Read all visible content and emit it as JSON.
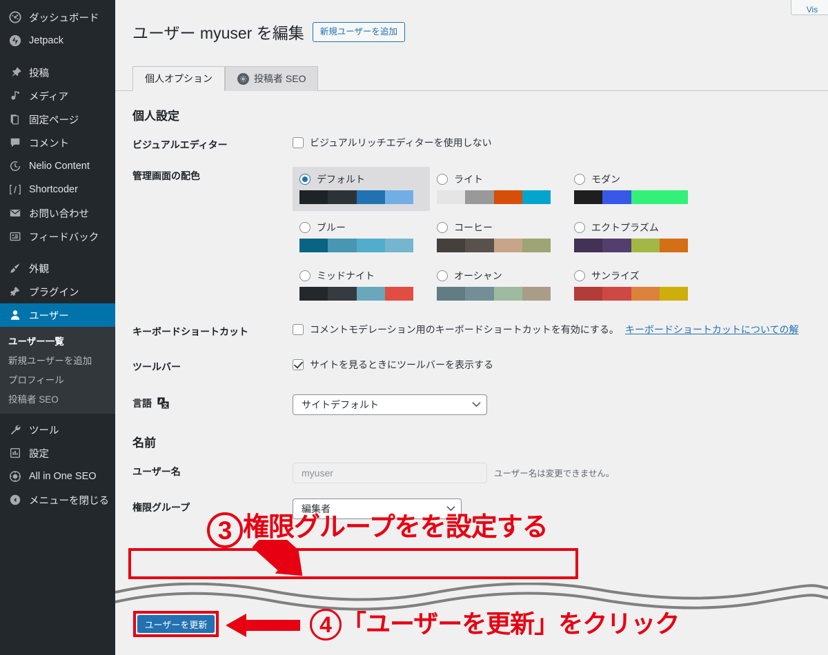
{
  "sidebar": {
    "items": [
      {
        "label": "ダッシュボード",
        "icon": "dashboard-icon",
        "active": false
      },
      {
        "label": "Jetpack",
        "icon": "jetpack-icon",
        "active": false
      },
      {
        "label": "投稿",
        "icon": "pin-icon",
        "active": false
      },
      {
        "label": "メディア",
        "icon": "media-icon",
        "active": false
      },
      {
        "label": "固定ページ",
        "icon": "pages-icon",
        "active": false
      },
      {
        "label": "コメント",
        "icon": "comment-icon",
        "active": false
      },
      {
        "label": "Nelio Content",
        "icon": "clock-icon",
        "active": false
      },
      {
        "label": "Shortcoder",
        "icon": "code-icon",
        "active": false
      },
      {
        "label": "お問い合わせ",
        "icon": "mail-icon",
        "active": false
      },
      {
        "label": "フィードバック",
        "icon": "feedback-icon",
        "active": false
      },
      {
        "label": "外観",
        "icon": "brush-icon",
        "active": false
      },
      {
        "label": "プラグイン",
        "icon": "plugin-icon",
        "active": false
      },
      {
        "label": "ユーザー",
        "icon": "user-icon",
        "active": true
      }
    ],
    "submenu": [
      {
        "label": "ユーザー一覧",
        "current": true
      },
      {
        "label": "新規ユーザーを追加",
        "current": false
      },
      {
        "label": "プロフィール",
        "current": false
      },
      {
        "label": "投稿者 SEO",
        "current": false
      }
    ],
    "items_bottom": [
      {
        "label": "ツール",
        "icon": "wrench-icon",
        "active": false
      },
      {
        "label": "設定",
        "icon": "settings-icon",
        "active": false
      },
      {
        "label": "All in One SEO",
        "icon": "aioseo-icon",
        "active": false
      },
      {
        "label": "メニューを閉じる",
        "icon": "collapse-icon",
        "active": false
      }
    ]
  },
  "header": {
    "title": "ユーザー myuser を編集",
    "add_new_label": "新規ユーザーを追加",
    "corner_button_label": "Vis"
  },
  "tabs": [
    {
      "label": "個人オプション",
      "icon": null,
      "active": true
    },
    {
      "label": "投稿者 SEO",
      "icon": "gear-icon",
      "active": false
    }
  ],
  "personal_settings": {
    "heading": "個人設定",
    "visual_editor": {
      "label": "ビジュアルエディター",
      "checkbox_label": "ビジュアルリッチエディターを使用しない",
      "checked": false
    },
    "admin_color_scheme": {
      "label": "管理画面の配色",
      "schemes": [
        {
          "name": "デフォルト",
          "selected": true,
          "colors": [
            "#1d2327",
            "#2c3338",
            "#2271b1",
            "#72aee6"
          ]
        },
        {
          "name": "ライト",
          "selected": false,
          "colors": [
            "#e5e5e5",
            "#999999",
            "#d64e07",
            "#04a4cc"
          ]
        },
        {
          "name": "モダン",
          "selected": false,
          "colors": [
            "#1e1e1e",
            "#3858e9",
            "#33f078",
            "#33f078"
          ]
        },
        {
          "name": "ブルー",
          "selected": false,
          "colors": [
            "#096484",
            "#4796b3",
            "#52accc",
            "#74b6ce"
          ]
        },
        {
          "name": "コーヒー",
          "selected": false,
          "colors": [
            "#46403c",
            "#59524c",
            "#c7a589",
            "#9ea476"
          ]
        },
        {
          "name": "エクトプラズム",
          "selected": false,
          "colors": [
            "#413256",
            "#523f6d",
            "#a3b745",
            "#d46f15"
          ]
        },
        {
          "name": "ミッドナイト",
          "selected": false,
          "colors": [
            "#25282b",
            "#363b3f",
            "#69a8bb",
            "#e14d43"
          ]
        },
        {
          "name": "オーシャン",
          "selected": false,
          "colors": [
            "#627c83",
            "#738e96",
            "#9ebaa0",
            "#aa9d88"
          ]
        },
        {
          "name": "サンライズ",
          "selected": false,
          "colors": [
            "#b43c38",
            "#cf4944",
            "#dd823b",
            "#ccaf0b"
          ]
        }
      ]
    },
    "keyboard_shortcuts": {
      "label": "キーボードショートカット",
      "checkbox_label": "コメントモデレーション用のキーボードショートカットを有効にする。",
      "link_label": "キーボードショートカットについての解",
      "checked": false
    },
    "toolbar": {
      "label": "ツールバー",
      "checkbox_label": "サイトを見るときにツールバーを表示する",
      "checked": true
    },
    "language": {
      "label": "言語",
      "value": "サイトデフォルト",
      "options": [
        "サイトデフォルト"
      ]
    }
  },
  "name_section": {
    "heading": "名前",
    "username": {
      "label": "ユーザー名",
      "value": "myuser",
      "description": "ユーザー名は変更できません。"
    },
    "role": {
      "label": "権限グループ",
      "value": "編集者",
      "options": [
        "編集者"
      ]
    }
  },
  "footer": {
    "update_button_label": "ユーザーを更新"
  },
  "annotations": [
    {
      "id": "step3",
      "number": "③",
      "text": "権限グループをを設定する"
    },
    {
      "id": "step4",
      "number": "④",
      "text": "「ユーザーを更新」をクリック"
    }
  ],
  "colors": {
    "accent": "#2271b1",
    "annotation_red": "#e60012",
    "sidebar_bg": "#23282d",
    "submenu_bg": "#32373c",
    "content_bg": "#f0f0f1"
  }
}
